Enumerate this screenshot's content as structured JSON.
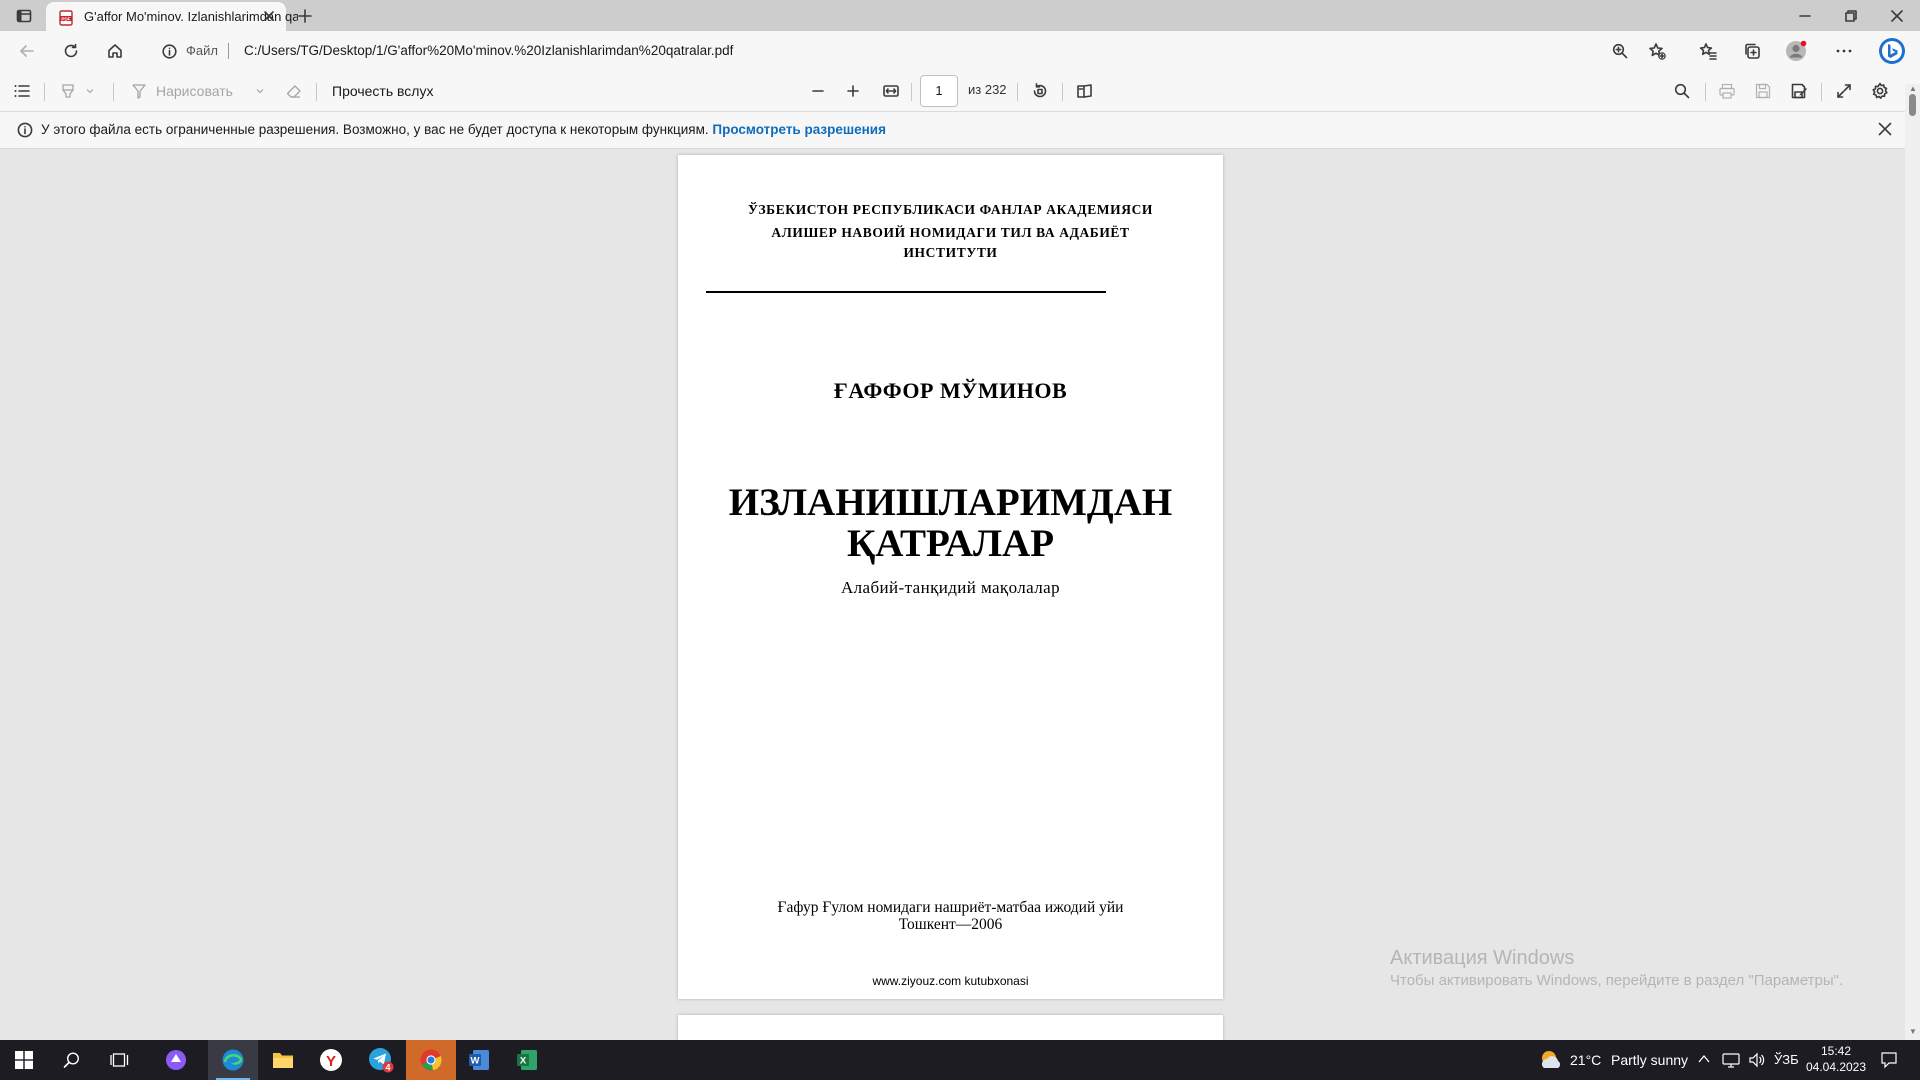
{
  "browser": {
    "tab_title": "G'affor Mo'minov. Izlanishlarimdan qatralar.pdf",
    "address_scheme": "Файл",
    "address_url": "C:/Users/TG/Desktop/1/G'affor%20Mo'minov.%20Izlanishlarimdan%20qatralar.pdf"
  },
  "pdf_toolbar": {
    "draw_label": "Нарисовать",
    "read_aloud_label": "Прочесть вслух",
    "page_current": "1",
    "page_total": "из 232"
  },
  "permission_bar": {
    "message": "У этого файла есть ограниченные разрешения. Возможно, у вас не будет доступа к некоторым функциям.",
    "link": "Просмотреть разрешения"
  },
  "document": {
    "institution_line1": "ЎЗБЕКИСТОН РЕСПУБЛИКАСИ ФАНЛАР АКАДЕМИЯСИ",
    "institution_line2": "АЛИШЕР НАВОИЙ НОМИДАГИ ТИЛ ВА АДАБИЁТ",
    "institution_line3": "ИНСТИТУТИ",
    "author": "ҒАФФОР МЎМИНОВ",
    "title_line1": "ИЗЛАНИШЛАРИМДАН",
    "title_line2": "ҚАТРАЛАР",
    "subtitle": "Алабий-танқидий мақолалар",
    "publisher": "Ғафур Ғулом номидаги нашриёт-матбаа ижодий уйи",
    "city_year": "Тошкент—2006",
    "website": "www.ziyouz.com kutubxonasi"
  },
  "watermark": {
    "title": "Активация Windows",
    "subtitle": "Чтобы активировать Windows, перейдите в раздел \"Параметры\"."
  },
  "taskbar": {
    "weather_temp": "21°C",
    "weather_text": "Partly sunny",
    "language": "ЎЗБ",
    "time": "15:42",
    "date": "04.04.2023",
    "telegram_badge": "4"
  },
  "colors": {
    "link": "#0f6cbd",
    "taskbar": "#1c1c22",
    "chrome_background": "#f7f7f7"
  }
}
